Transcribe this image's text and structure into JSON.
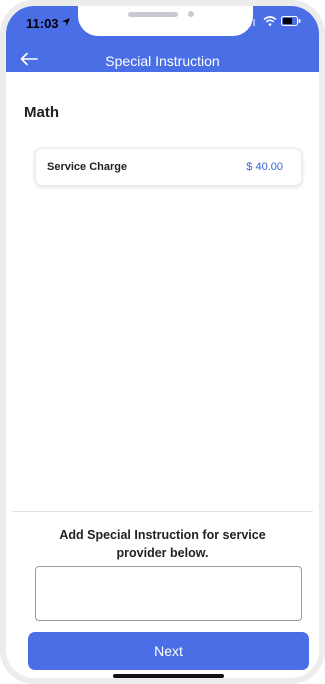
{
  "status_bar": {
    "time": "11:03"
  },
  "header": {
    "title": "Special Instruction",
    "back_icon": "arrow-left-icon"
  },
  "category": {
    "title": "Math"
  },
  "service": {
    "label": "Service Charge",
    "price": "$ 40.00"
  },
  "instructions": {
    "prompt": "Add Special Instruction for service provider below.",
    "value": "",
    "placeholder": ""
  },
  "footer": {
    "next_label": "Next"
  },
  "colors": {
    "primary": "#4a6ee6",
    "price": "#3e63d9"
  }
}
